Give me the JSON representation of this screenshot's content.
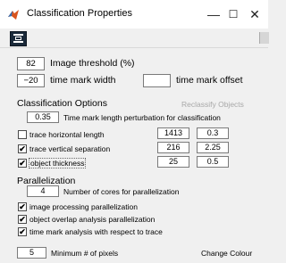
{
  "window": {
    "title": "Classification Properties",
    "minimize": "—",
    "maximize": "☐",
    "close": "✕"
  },
  "threshold": {
    "value": "82",
    "label": "Image threshold (%)"
  },
  "timemark_width": {
    "value": "−20",
    "label": "time mark width"
  },
  "timemark_offset": {
    "value": "",
    "label": "time mark offset"
  },
  "classification": {
    "heading": "Classification Options",
    "reclassify_label": "Reclassify Objects",
    "perturbation": {
      "value": "0.35",
      "label": "Time mark length perturbation for classification"
    },
    "options": [
      {
        "label": "trace horizontal length",
        "checked": false,
        "val1": "1413",
        "val2": "0.3"
      },
      {
        "label": "trace vertical separation",
        "checked": true,
        "val1": "216",
        "val2": "2.25"
      },
      {
        "label": "object thickness",
        "checked": true,
        "val1": "25",
        "val2": "0.5"
      }
    ]
  },
  "parallelization": {
    "heading": "Parallelization",
    "cores": {
      "value": "4",
      "label": "Number of cores for parallelization"
    },
    "options": [
      {
        "label": "image processing parallelization",
        "checked": true
      },
      {
        "label": "object overlap analysis parallelization",
        "checked": true
      },
      {
        "label": "time mark analysis with respect to trace",
        "checked": true
      }
    ]
  },
  "min_pixels": {
    "value": "5",
    "label": "Minimum # of pixels"
  },
  "change_colour_label": "Change Colour"
}
